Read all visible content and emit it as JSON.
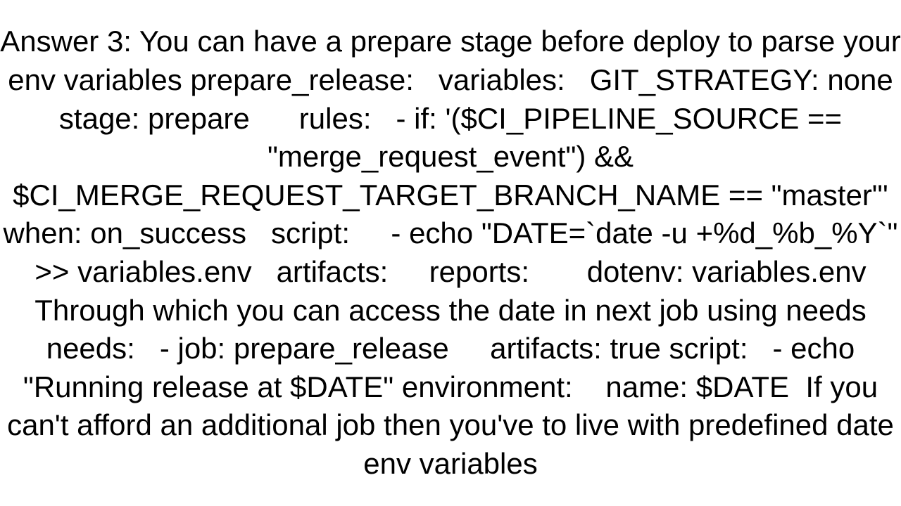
{
  "answer": {
    "label": "Answer 3:",
    "text": "Answer 3: You can have a prepare stage before deploy to parse your env variables prepare_release:   variables:   GIT_STRATEGY: none   stage: prepare      rules:   - if: '($CI_PIPELINE_SOURCE == \"merge_request_event\") && $CI_MERGE_REQUEST_TARGET_BRANCH_NAME == \"master\"'       when: on_success   script:     - echo \"DATE=`date -u +%d_%b_%Y`\" >> variables.env   artifacts:     reports:       dotenv: variables.env  Through which you can access the date in next job using needs needs:   - job: prepare_release     artifacts: true script:   - echo \"Running release at $DATE\" environment:    name: $DATE  If you can't afford an additional job then you've to live with predefined date env variables"
  }
}
